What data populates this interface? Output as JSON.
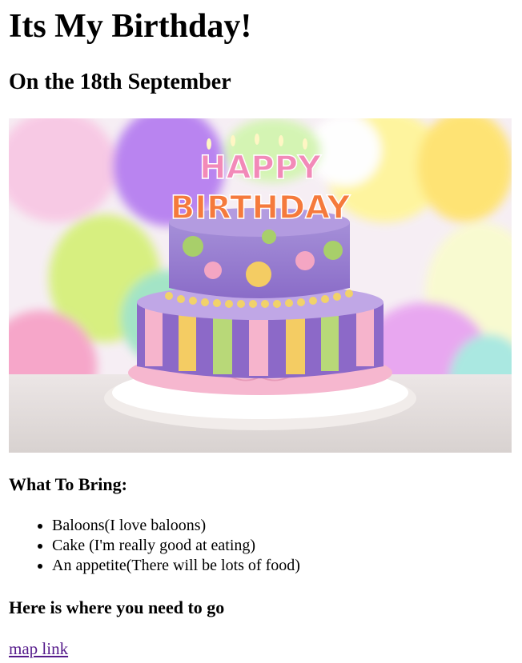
{
  "page": {
    "title": "Its My Birthday!",
    "subtitle": "On the 18th September"
  },
  "hero_image": {
    "alt": "Birthday cake with Happy Birthday candles",
    "candle_top": "HAPPY",
    "candle_bottom": "BIRTHDAY"
  },
  "bring": {
    "title": "What To Bring:",
    "items": [
      "Baloons(I love baloons)",
      "Cake (I'm really good at eating)",
      "An appetite(There will be lots of food)"
    ]
  },
  "directions": {
    "title": "Here is where you need to go",
    "link_label": "map link"
  },
  "colors": {
    "link_visited": "#551a8b"
  }
}
